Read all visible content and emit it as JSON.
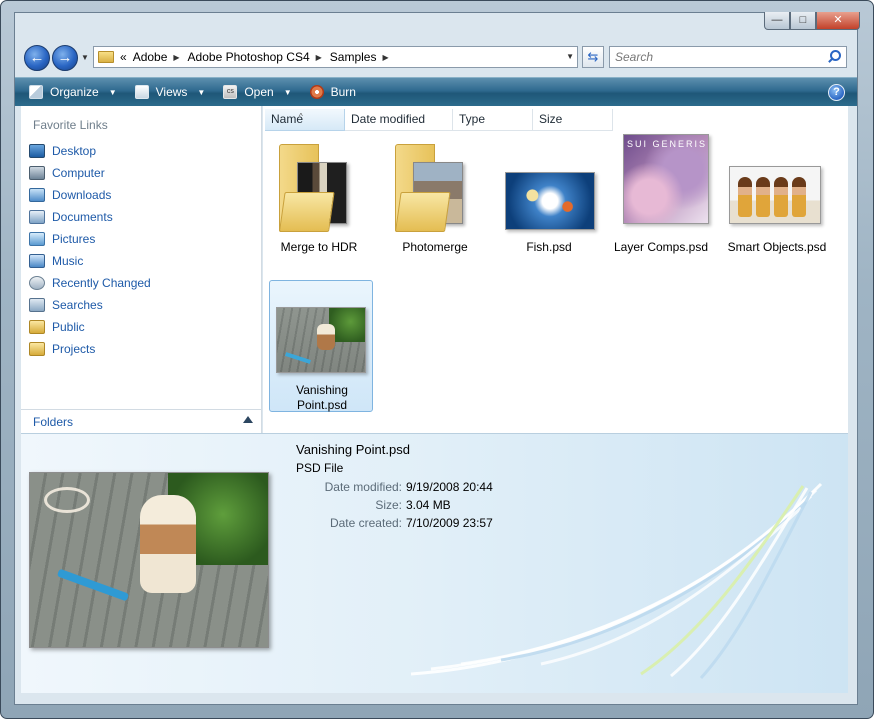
{
  "window": {
    "caption_buttons": {
      "minimize": "—",
      "maximize": "□",
      "close": "✕"
    }
  },
  "address": {
    "overflow": "«",
    "crumbs": [
      "Adobe",
      "Adobe Photoshop CS4",
      "Samples"
    ],
    "search_placeholder": "Search"
  },
  "toolbar": {
    "organize": "Organize",
    "views": "Views",
    "open": "Open",
    "burn": "Burn",
    "help": "?"
  },
  "nav": {
    "favorite_links_title": "Favorite Links",
    "items": [
      {
        "label": "Desktop",
        "icon": "desktop-icon"
      },
      {
        "label": "Computer",
        "icon": "computer-icon"
      },
      {
        "label": "Downloads",
        "icon": "downloads-icon"
      },
      {
        "label": "Documents",
        "icon": "documents-icon"
      },
      {
        "label": "Pictures",
        "icon": "pictures-icon"
      },
      {
        "label": "Music",
        "icon": "music-icon"
      },
      {
        "label": "Recently Changed",
        "icon": "recently-changed-icon"
      },
      {
        "label": "Searches",
        "icon": "searches-icon"
      },
      {
        "label": "Public",
        "icon": "folder-icon"
      },
      {
        "label": "Projects",
        "icon": "folder-icon"
      }
    ],
    "folders_label": "Folders"
  },
  "columns": [
    "Name",
    "Date modified",
    "Type",
    "Size"
  ],
  "sorted_column": "Name",
  "files": [
    {
      "name": "Merge to HDR",
      "kind": "folder"
    },
    {
      "name": "Photomerge",
      "kind": "folder"
    },
    {
      "name": "Fish.psd",
      "kind": "image"
    },
    {
      "name": "Layer Comps.psd",
      "kind": "image",
      "thumb_text": "SUI GENERIS"
    },
    {
      "name": "Smart Objects.psd",
      "kind": "image"
    },
    {
      "name": "Vanishing Point.psd",
      "kind": "image",
      "selected": true
    }
  ],
  "details": {
    "name": "Vanishing Point.psd",
    "type": "PSD File",
    "rows": [
      {
        "key": "Date modified:",
        "value": "9/19/2008 20:44"
      },
      {
        "key": "Size:",
        "value": "3.04 MB"
      },
      {
        "key": "Date created:",
        "value": "7/10/2009 23:57"
      }
    ]
  },
  "colors": {
    "toolbar": "#2f6a8f",
    "link": "#1e5aa8",
    "selection": "#cfe6f8"
  }
}
